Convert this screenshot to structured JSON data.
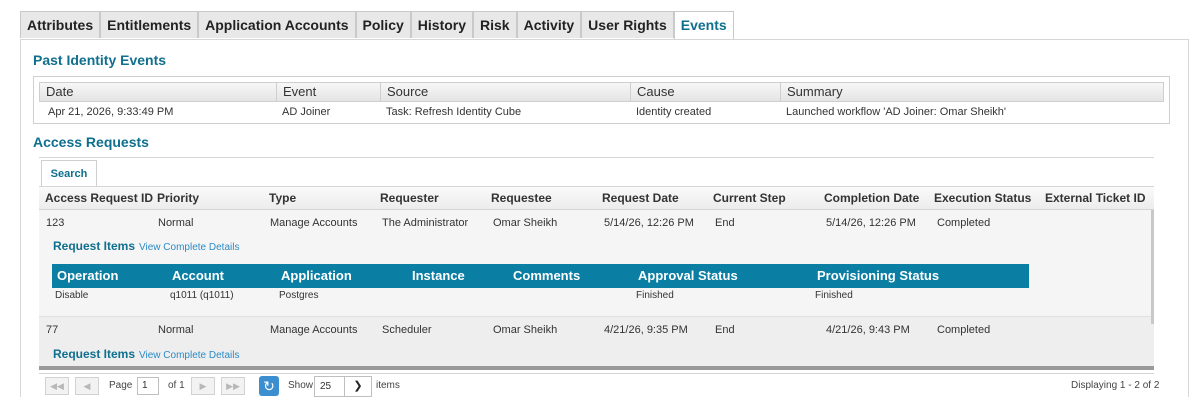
{
  "tabs": [
    "Attributes",
    "Entitlements",
    "Application Accounts",
    "Policy",
    "History",
    "Risk",
    "Activity",
    "User Rights",
    "Events"
  ],
  "active_tab": "Events",
  "past_events": {
    "title": "Past Identity Events",
    "columns": [
      "Date",
      "Event",
      "Source",
      "Cause",
      "Summary"
    ],
    "rows": [
      [
        "Apr 21, 2026, 9:33:49 PM",
        "AD Joiner",
        "Task: Refresh Identity Cube",
        "Identity created",
        "Launched workflow 'AD Joiner: Omar Sheikh'"
      ]
    ]
  },
  "access_requests": {
    "title": "Access Requests",
    "search_tab": "Search",
    "columns": [
      "Access Request ID",
      "Priority",
      "Type",
      "Requester",
      "Requestee",
      "Request Date",
      "Current Step",
      "Completion Date",
      "Execution Status",
      "External Ticket ID"
    ],
    "rows": [
      {
        "cells": [
          "123",
          "Normal",
          "Manage Accounts",
          "The Administrator",
          "Omar Sheikh",
          "5/14/26, 12:26 PM",
          "End",
          "5/14/26, 12:26 PM",
          "Completed",
          ""
        ],
        "request_items_label": "Request Items",
        "details_link": "View Complete Details",
        "items_columns": [
          "Operation",
          "Account",
          "Application",
          "Instance",
          "Comments",
          "Approval Status",
          "Provisioning Status"
        ],
        "items": [
          [
            "Disable",
            "q1011 (q1011)",
            "Postgres",
            "",
            "",
            "Finished",
            "Finished"
          ]
        ]
      },
      {
        "cells": [
          "77",
          "Normal",
          "Manage Accounts",
          "Scheduler",
          "Omar Sheikh",
          "4/21/26, 9:35 PM",
          "End",
          "4/21/26, 9:43 PM",
          "Completed",
          ""
        ],
        "request_items_label": "Request Items",
        "details_link": "View Complete Details"
      }
    ]
  },
  "pager": {
    "page_label": "Page",
    "page_value": "1",
    "of_label": "of 1",
    "show_label": "Show",
    "page_size": "25",
    "items_label": "items",
    "display_text": "Displaying 1 - 2 of 2"
  },
  "icons": {
    "first": "first-page-icon",
    "prev": "prev-page-icon",
    "next": "next-page-icon",
    "last": "last-page-icon",
    "refresh": "refresh-icon",
    "dropdown": "chevron-down-icon"
  },
  "colors": {
    "accent": "#0f6f8e",
    "items_header": "#0b7ea3",
    "link": "#2a8bc6"
  }
}
